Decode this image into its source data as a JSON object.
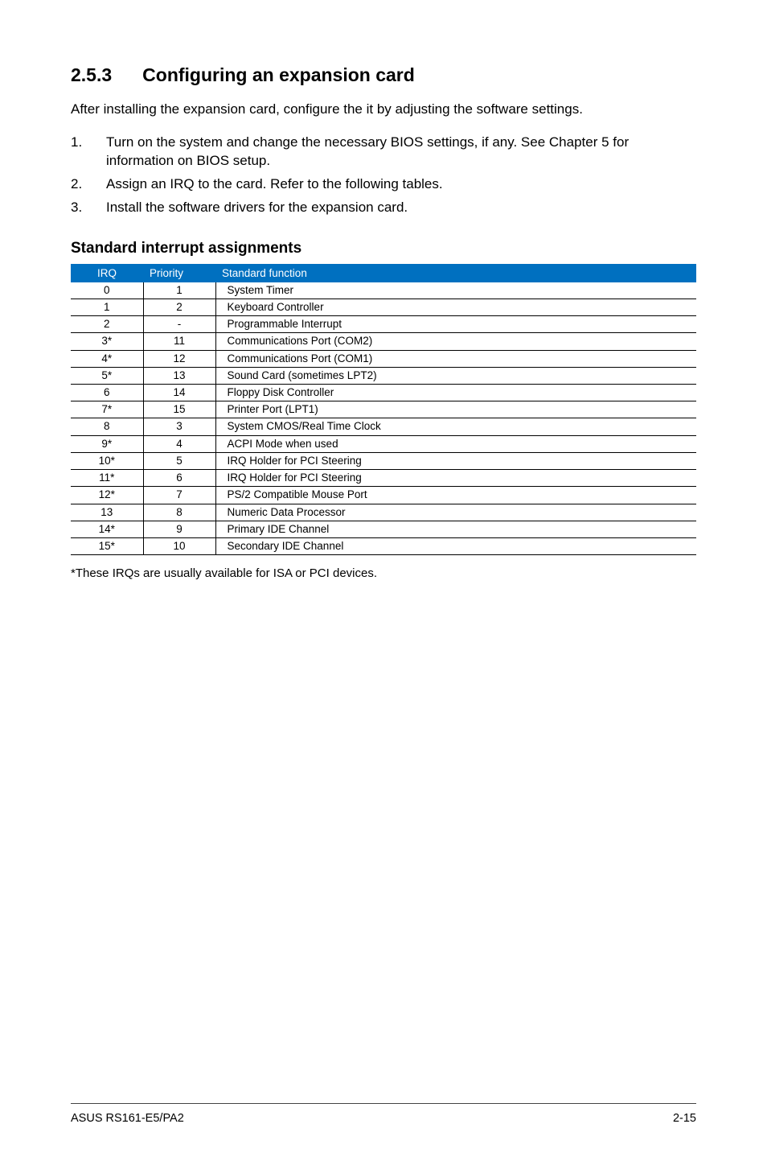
{
  "heading": {
    "number": "2.5.3",
    "title": "Configuring an expansion card"
  },
  "intro": "After installing the expansion card, configure the it by adjusting the software settings.",
  "steps": [
    {
      "num": "1.",
      "text": "Turn on the system and change the necessary BIOS settings, if any. See Chapter 5 for information on BIOS setup."
    },
    {
      "num": "2.",
      "text": "Assign an IRQ to the card. Refer to the following tables."
    },
    {
      "num": "3.",
      "text": "Install the software drivers for the expansion card."
    }
  ],
  "subheading": "Standard interrupt assignments",
  "table": {
    "headers": [
      "IRQ",
      "Priority",
      "Standard function"
    ],
    "rows": [
      [
        "0",
        "1",
        "System Timer"
      ],
      [
        "1",
        "2",
        "Keyboard Controller"
      ],
      [
        "2",
        "-",
        "Programmable Interrupt"
      ],
      [
        "3*",
        "11",
        "Communications Port (COM2)"
      ],
      [
        "4*",
        "12",
        "Communications Port (COM1)"
      ],
      [
        "5*",
        "13",
        "Sound Card (sometimes LPT2)"
      ],
      [
        "6",
        "14",
        "Floppy Disk Controller"
      ],
      [
        "7*",
        "15",
        "Printer Port (LPT1)"
      ],
      [
        "8",
        "3",
        "System CMOS/Real Time Clock"
      ],
      [
        "9*",
        "4",
        "ACPI Mode when used"
      ],
      [
        "10*",
        "5",
        "IRQ Holder for PCI Steering"
      ],
      [
        "11*",
        "6",
        "IRQ Holder for PCI Steering"
      ],
      [
        "12*",
        "7",
        "PS/2 Compatible Mouse Port"
      ],
      [
        "13",
        "8",
        "Numeric Data Processor"
      ],
      [
        "14*",
        "9",
        "Primary IDE Channel"
      ],
      [
        "15*",
        "10",
        "Secondary IDE Channel"
      ]
    ]
  },
  "footnote": "*These IRQs are usually available for ISA or PCI devices.",
  "footer": {
    "left": "ASUS RS161-E5/PA2",
    "right": "2-15"
  }
}
